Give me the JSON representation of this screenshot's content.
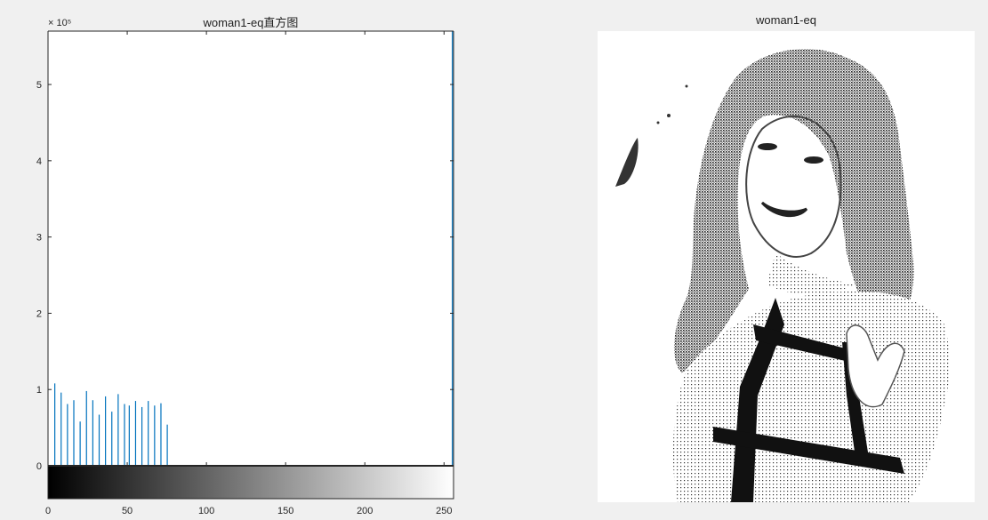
{
  "figure": {
    "left_title": "woman1-eq直方图",
    "right_title": "woman1-eq"
  },
  "chart_data": {
    "type": "bar",
    "title": "woman1-eq直方图",
    "xlabel": "",
    "ylabel": "",
    "xlim": [
      0,
      256
    ],
    "ylim": [
      0,
      570000
    ],
    "y_exponent_label": "× 10⁵",
    "y_ticks": [
      0,
      100000,
      200000,
      300000,
      400000,
      500000
    ],
    "y_tick_labels": [
      "0",
      "1",
      "2",
      "3",
      "4",
      "5"
    ],
    "x_ticks": [
      0,
      50,
      100,
      150,
      200,
      250
    ],
    "x_tick_labels": [
      "0",
      "50",
      "100",
      "150",
      "200",
      "250"
    ],
    "colorbar": "gray",
    "series": [
      {
        "x": [
          4,
          8,
          12,
          16,
          20,
          24,
          28,
          32,
          36,
          40,
          44,
          48,
          51,
          55,
          59,
          63,
          67,
          71,
          75,
          255
        ],
        "values": [
          108000,
          96000,
          81000,
          86000,
          58000,
          98000,
          86000,
          67000,
          91000,
          71000,
          94000,
          81000,
          79000,
          85000,
          77000,
          85000,
          79000,
          82000,
          54000,
          570000
        ]
      }
    ],
    "bar_color": "#0072BD"
  },
  "image_panel": {
    "title": "woman1-eq"
  }
}
